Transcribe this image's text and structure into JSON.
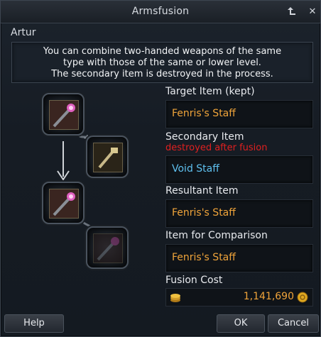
{
  "window": {
    "title": "Armsfusion",
    "character": "Artur"
  },
  "info": {
    "lines": [
      "You can combine two-handed weapons of the same",
      "type with those of the same or lower level.",
      "The secondary item is destroyed in the process."
    ]
  },
  "target": {
    "label": "Target Item (kept)",
    "value": "Fenris's Staff"
  },
  "secondary": {
    "label": "Secondary Item",
    "warning": "destroyed after fusion",
    "value": "Void Staff"
  },
  "resultant": {
    "label": "Resultant Item",
    "value": "Fenris's Staff"
  },
  "comparison": {
    "label": "Item for Comparison",
    "value": "Fenris's Staff"
  },
  "cost": {
    "label": "Fusion Cost",
    "value": "1,141,690"
  },
  "buttons": {
    "help": "Help",
    "ok": "OK",
    "cancel": "Cancel"
  },
  "icons": {
    "pin": "pin-icon",
    "close": "close-icon",
    "staff": "staff-icon",
    "coins": "coins-icon",
    "gold": "gold-icon"
  },
  "colors": {
    "item_name": "#f0a43a",
    "secondary_name": "#5fc1f0",
    "warning": "#e02020"
  }
}
